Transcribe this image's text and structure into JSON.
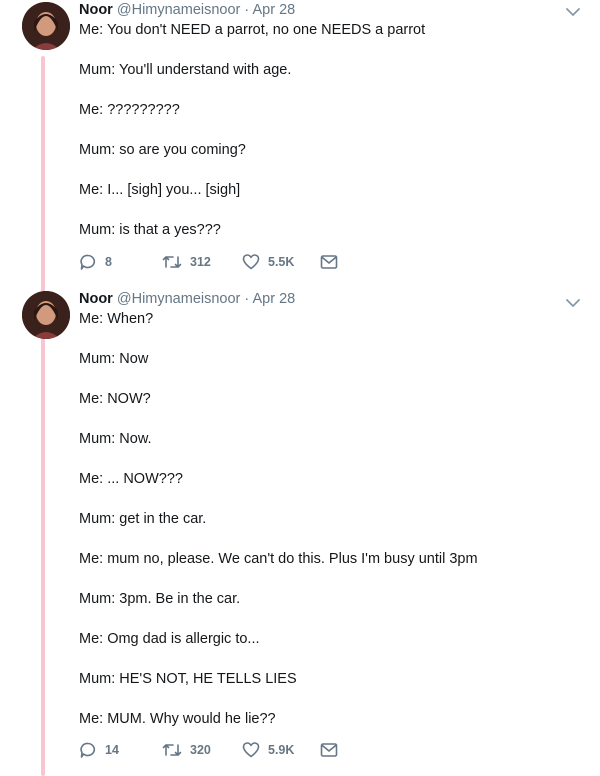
{
  "tweets": [
    {
      "author_name": "Noor",
      "handle": "@Himynameisnoor",
      "separator": "·",
      "date": "Apr 28",
      "lines": [
        "Me: You don't NEED a parrot, no one NEEDS a parrot",
        "Mum: You'll understand with age.",
        "Me: ?????????",
        "Mum: so are you coming?",
        "Me: I... [sigh] you... [sigh]",
        "Mum: is that a yes???"
      ],
      "replies": "8",
      "retweets": "312",
      "likes": "5.5K"
    },
    {
      "author_name": "Noor",
      "handle": "@Himynameisnoor",
      "separator": "·",
      "date": "Apr 28",
      "lines": [
        "Me: When?",
        "Mum: Now",
        "Me: NOW?",
        "Mum: Now.",
        "Me: ... NOW???",
        "Mum: get in the car.",
        "Me: mum no, please. We can't do this. Plus I'm busy until 3pm",
        "Mum: 3pm. Be in the car.",
        "Me: Omg dad is allergic to...",
        "Mum: HE'S NOT, HE TELLS LIES",
        "Me: MUM. Why would he lie??"
      ],
      "replies": "14",
      "retweets": "320",
      "likes": "5.9K"
    }
  ],
  "icons": {
    "reply": "reply-icon",
    "retweet": "retweet-icon",
    "like": "heart-icon",
    "message": "envelope-icon",
    "caret": "chevron-down-icon"
  },
  "colors": {
    "thread_line": "#f7c6d0",
    "secondary_text": "#657786",
    "primary_text": "#14171a"
  }
}
